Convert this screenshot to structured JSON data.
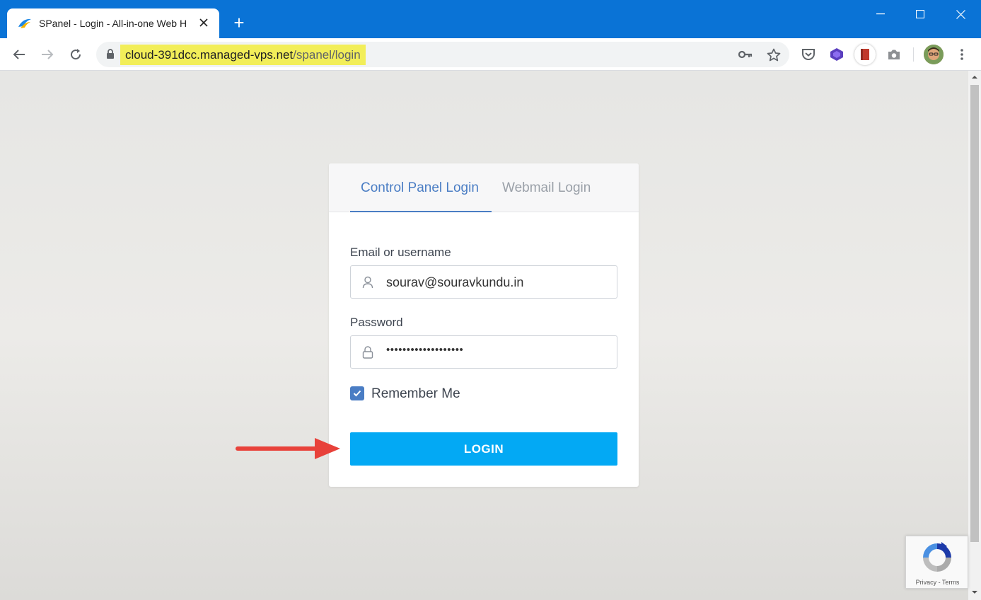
{
  "browser": {
    "tab_title": "SPanel - Login - All-in-one Web H",
    "new_tab": "+",
    "url_host": "cloud-391dcc.managed-vps.net",
    "url_path": "/spanel/login"
  },
  "login": {
    "tab_control_panel": "Control Panel Login",
    "tab_webmail": "Webmail Login",
    "email_label": "Email or username",
    "email_value": "sourav@souravkundu.in",
    "password_label": "Password",
    "password_value": "•••••••••••••••••••",
    "remember_label": "Remember Me",
    "remember_checked": true,
    "login_button": "LOGIN"
  },
  "recaptcha": {
    "text": "Privacy - Terms"
  },
  "colors": {
    "accent": "#4a7dc4",
    "button": "#03a9f4",
    "titlebar": "#0a73d6",
    "url_highlight": "#f2ee59",
    "arrow": "#e8413a"
  }
}
